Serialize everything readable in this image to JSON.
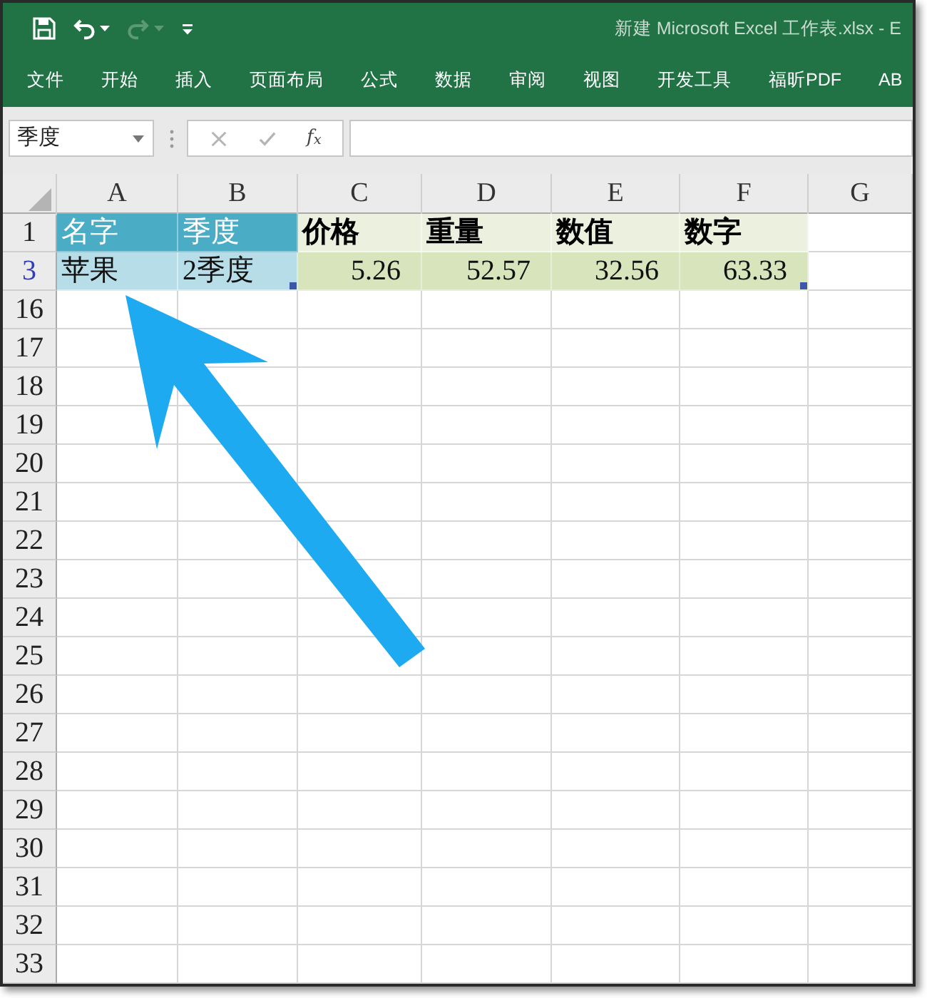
{
  "window": {
    "title": "新建 Microsoft Excel 工作表.xlsx - E"
  },
  "quick_access": [
    {
      "kind": "save",
      "disabled": false,
      "dropdown": false
    },
    {
      "kind": "undo",
      "disabled": false,
      "dropdown": true
    },
    {
      "kind": "redo",
      "disabled": true,
      "dropdown": true
    },
    {
      "kind": "customize",
      "disabled": false,
      "dropdown": false
    }
  ],
  "ribbon": {
    "tabs": [
      {
        "label": "文件",
        "selected": false
      },
      {
        "label": "开始",
        "selected": false
      },
      {
        "label": "插入",
        "selected": false
      },
      {
        "label": "页面布局",
        "selected": false
      },
      {
        "label": "公式",
        "selected": false
      },
      {
        "label": "数据",
        "selected": false
      },
      {
        "label": "审阅",
        "selected": false
      },
      {
        "label": "视图",
        "selected": false
      },
      {
        "label": "开发工具",
        "selected": false
      },
      {
        "label": "福昕PDF",
        "selected": false
      },
      {
        "label": "AB",
        "selected": false
      }
    ]
  },
  "name_box": {
    "value": "季度"
  },
  "formula_bar": {
    "buttons": [
      {
        "kind": "cancel",
        "disabled": true
      },
      {
        "kind": "enter",
        "disabled": true
      },
      {
        "kind": "function",
        "label": "f$_{x}$",
        "disabled": false
      }
    ]
  },
  "sheet": {
    "columns": [
      {
        "label": "A"
      },
      {
        "label": "B"
      },
      {
        "label": "C"
      },
      {
        "label": "D"
      },
      {
        "label": "E"
      },
      {
        "label": "F"
      },
      {
        "label": "G"
      }
    ],
    "rows": [
      {
        "number": "1",
        "filtered": false,
        "cells": [
          {
            "text": "名字",
            "kind": "blue_header",
            "handle": false
          },
          {
            "text": "季度",
            "kind": "blue_header",
            "handle": false
          },
          {
            "text": "价格",
            "kind": "green_header",
            "handle": false
          },
          {
            "text": "重量",
            "kind": "green_header",
            "handle": false
          },
          {
            "text": "数值",
            "kind": "green_header",
            "handle": false
          },
          {
            "text": "数字",
            "kind": "green_header",
            "handle": false
          }
        ]
      },
      {
        "number": "3",
        "filtered": true,
        "cells": [
          {
            "text": "苹果",
            "kind": "blue_body",
            "handle": false
          },
          {
            "text": "2季度",
            "kind": "blue_body",
            "handle": true
          },
          {
            "text": "5.26",
            "kind": "green_body",
            "handle": false
          },
          {
            "text": "52.57",
            "kind": "green_body",
            "handle": false
          },
          {
            "text": "32.56",
            "kind": "green_body",
            "handle": false
          },
          {
            "text": "63.33",
            "kind": "green_body",
            "handle": true
          }
        ]
      },
      {
        "number": "16",
        "filtered": false
      },
      {
        "number": "17",
        "filtered": false
      },
      {
        "number": "18",
        "filtered": false
      },
      {
        "number": "19",
        "filtered": false
      },
      {
        "number": "20",
        "filtered": false
      },
      {
        "number": "21",
        "filtered": false
      },
      {
        "number": "22",
        "filtered": false
      },
      {
        "number": "23",
        "filtered": false
      },
      {
        "number": "24",
        "filtered": false
      },
      {
        "number": "25",
        "filtered": false
      },
      {
        "number": "26",
        "filtered": false
      },
      {
        "number": "27",
        "filtered": false
      },
      {
        "number": "28",
        "filtered": false
      },
      {
        "number": "29",
        "filtered": false
      },
      {
        "number": "30",
        "filtered": false
      },
      {
        "number": "31",
        "filtered": false
      },
      {
        "number": "32",
        "filtered": false
      },
      {
        "number": "33",
        "filtered": false
      }
    ]
  }
}
